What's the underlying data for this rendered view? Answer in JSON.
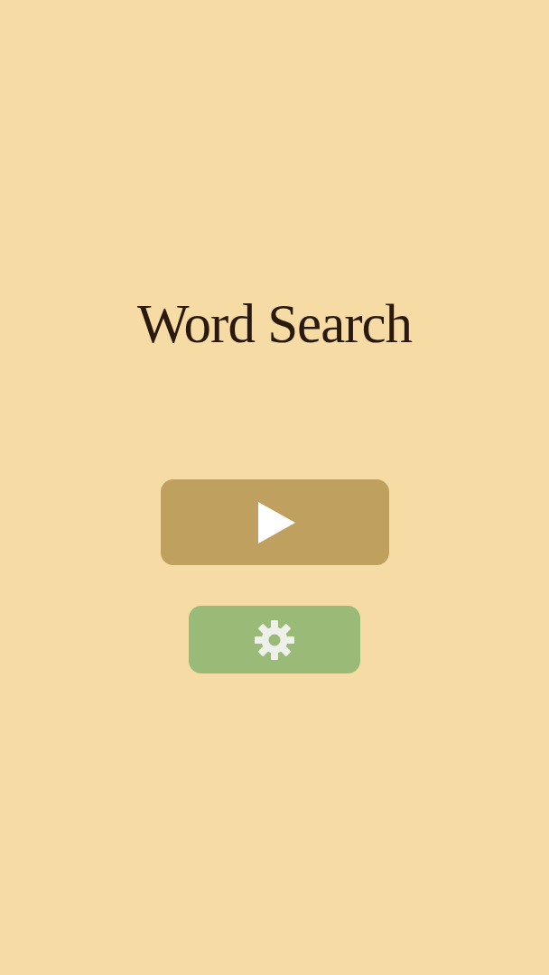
{
  "title": "Word Search",
  "buttons": [
    {
      "kind": "play"
    },
    {
      "kind": "settings"
    }
  ]
}
